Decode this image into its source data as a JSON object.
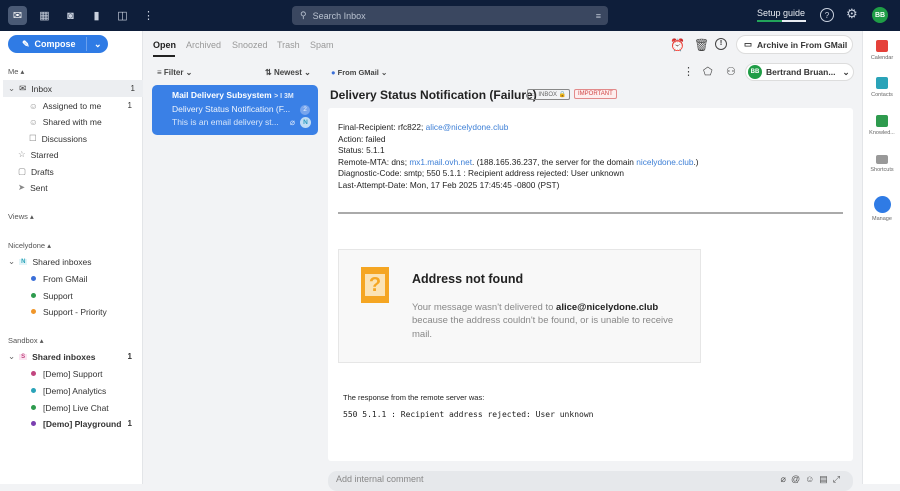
{
  "topbar": {
    "nav_icons": [
      "inbox-icon",
      "calendar-icon",
      "contacts-icon",
      "analytics-icon",
      "knowledge-icon",
      "more-icon"
    ],
    "search_placeholder": "Search Inbox",
    "setup_guide": "Setup guide",
    "setup_progress": 0.5,
    "avatar": "BB"
  },
  "sidebar": {
    "compose": "Compose",
    "me": {
      "title": "Me",
      "items": [
        {
          "label": "Inbox",
          "count": "1"
        },
        {
          "label": "Assigned to me",
          "count": "1"
        },
        {
          "label": "Shared with me",
          "count": ""
        },
        {
          "label": "Discussions",
          "count": ""
        },
        {
          "label": "Starred",
          "count": ""
        },
        {
          "label": "Drafts",
          "count": ""
        },
        {
          "label": "Sent",
          "count": ""
        }
      ]
    },
    "views": {
      "title": "Views"
    },
    "nicelydone": {
      "title": "Nicelydone",
      "group": "Shared inboxes",
      "badge": "N",
      "items": [
        {
          "label": "From GMail",
          "color": "#3b6fd8"
        },
        {
          "label": "Support",
          "color": "#2e9b4e"
        },
        {
          "label": "Support - Priority",
          "color": "#f0962a"
        }
      ]
    },
    "sandbox": {
      "title": "Sandbox",
      "group": "Shared inboxes",
      "badge": "S",
      "count": "1",
      "items": [
        {
          "label": "[Demo] Support",
          "color": "#c2457f",
          "count": ""
        },
        {
          "label": "[Demo] Analytics",
          "color": "#2aa3b8",
          "count": ""
        },
        {
          "label": "[Demo] Live Chat",
          "color": "#2e9b4e",
          "count": ""
        },
        {
          "label": "[Demo] Playground",
          "color": "#7b3fb0",
          "count": "1"
        }
      ]
    }
  },
  "list": {
    "tabs": [
      "Open",
      "Archived",
      "Snoozed",
      "Trash",
      "Spam"
    ],
    "filter": "Filter",
    "sort": "Newest",
    "item": {
      "sender": "Mail Delivery Subsystem",
      "time": "3M",
      "subject": "Delivery Status Notification (F...",
      "count": "2",
      "preview": "This is an email delivery st...",
      "assignee": "N"
    }
  },
  "main": {
    "archive_button": "Archive in From GMail",
    "inbox_filter": "From GMail",
    "assignee": "Bertrand Bruan...",
    "assignee_initials": "BB",
    "subject": "Delivery Status Notification (Failure)",
    "tag_inbox": "INBOX",
    "tag_important": "IMPORTANT",
    "body": {
      "lines": [
        {
          "text": "Final-Recipient: rfc822; ",
          "link": "alice@nicelydone.club",
          "after": ""
        },
        {
          "text": "Action: failed",
          "link": "",
          "after": ""
        },
        {
          "text": "Status: 5.1.1",
          "link": "",
          "after": ""
        },
        {
          "text": "Remote-MTA: dns; ",
          "link": "mx1.mail.ovh.net",
          "after": ". (188.165.36.237, the server for the domain ",
          "link2": "nicelydone.club",
          "after2": ".)"
        },
        {
          "text": "Diagnostic-Code: smtp; 550 5.1.1 : Recipient address rejected: User unknown",
          "link": "",
          "after": ""
        },
        {
          "text": "Last-Attempt-Date: Mon, 17 Feb 2025 17:45:45 -0800 (PST)",
          "link": "",
          "after": ""
        }
      ],
      "notice_title": "Address not found",
      "notice_pre": "Your message wasn't delivered to ",
      "notice_email": "alice@nicelydone.club",
      "notice_post": "because the address couldn't be found, or is unable to receive mail.",
      "response_label": "The response from the remote server was:",
      "response_code": "550 5.1.1 : Recipient address rejected: User unknown"
    },
    "comment_placeholder": "Add internal comment"
  },
  "rail": [
    {
      "label": "Calendar",
      "color": "#e5413a"
    },
    {
      "label": "Contacts",
      "color": "#2aa3b8"
    },
    {
      "label": "Knowled...",
      "color": "#2e9b4e"
    },
    {
      "label": "Shortcuts",
      "color": "#888888"
    },
    {
      "label": "Manage",
      "color": "#2f7be5"
    }
  ]
}
